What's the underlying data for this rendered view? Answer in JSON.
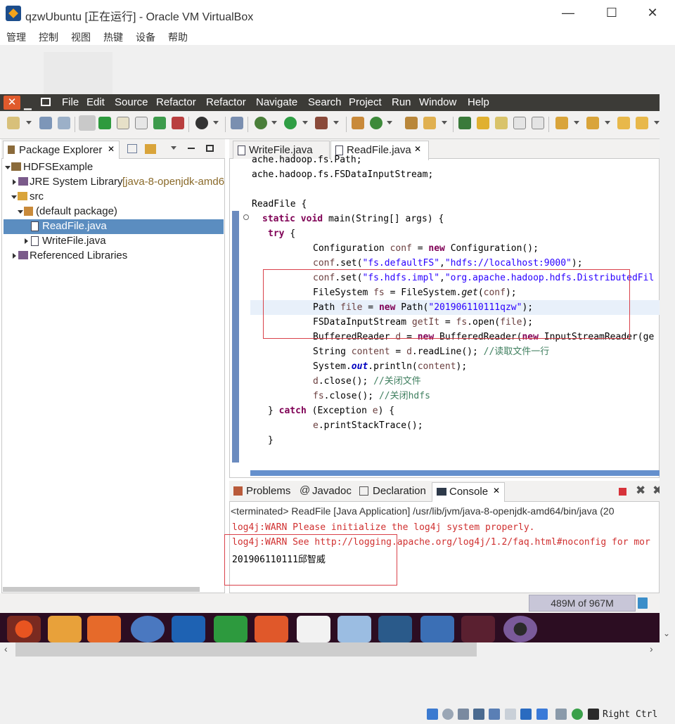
{
  "vbox": {
    "title": "qzwUbuntu [正在运行] - Oracle VM VirtualBox",
    "menu": [
      "管理",
      "控制",
      "视图",
      "热键",
      "设备",
      "帮助"
    ],
    "win_min": "—",
    "win_max": "☐",
    "win_close": "✕",
    "host_key": "Right Ctrl"
  },
  "eclipse": {
    "close_glyph": "✕",
    "min_glyph": "▁",
    "menu": [
      "File",
      "Edit",
      "Source",
      "Refactor",
      "Refactor",
      "Navigate",
      "Search",
      "Project",
      "Run",
      "Window",
      "Help"
    ],
    "package_explorer": {
      "tab_label": "Package Explorer",
      "tab_close": "✕",
      "tree": [
        {
          "label": "HDFSExample",
          "suffix": ""
        },
        {
          "label": "JRE System Library",
          "suffix": "[java-8-openjdk-amd6"
        },
        {
          "label": "src",
          "suffix": ""
        },
        {
          "label": "(default package)",
          "suffix": ""
        },
        {
          "label": "ReadFile.java",
          "suffix": ""
        },
        {
          "label": "WriteFile.java",
          "suffix": ""
        },
        {
          "label": "Referenced Libraries",
          "suffix": ""
        }
      ]
    },
    "editor": {
      "tabs": [
        {
          "label": "WriteFile.java",
          "active": false
        },
        {
          "label": "ReadFile.java",
          "active": true,
          "close": "✕"
        }
      ],
      "code": {
        "l1": "ache.hadoop.fs.Path;",
        "l2": "ache.hadoop.fs.FSDataInputStream;",
        "l4a": "ReadFile {",
        "l5a": "static",
        "l5b": "void",
        "l5c": "main(String[] args) {",
        "l6a": "try",
        "l6b": "{",
        "l7a": "Configuration",
        "l7b": "conf",
        "l7c": "=",
        "l7d": "new",
        "l7e": "Configuration();",
        "l8a": "conf",
        "l8b": ".set(",
        "l8c": "\"fs.defaultFS\"",
        "l8d": ",",
        "l8e": "\"hdfs://localhost:9000\"",
        "l8f": ");",
        "l9a": "conf",
        "l9b": ".set(",
        "l9c": "\"fs.hdfs.impl\"",
        "l9d": ",",
        "l9e": "\"org.apache.hadoop.hdfs.DistributedFil",
        "l10a": "FileSystem",
        "l10b": "fs",
        "l10c": "= FileSystem.",
        "l10d": "get",
        "l10e": "(",
        "l10f": "conf",
        "l10g": ");",
        "l11a": "Path",
        "l11b": "file",
        "l11c": "=",
        "l11d": "new",
        "l11e": "Path(",
        "l11f": "\"201906110111qzw\"",
        "l11g": ");",
        "l12a": "FSDataInputStream",
        "l12b": "getIt",
        "l12c": "=",
        "l12d": "fs",
        "l12e": ".open(",
        "l12f": "file",
        "l12g": ");",
        "l13a": "BufferedReader",
        "l13b": "d",
        "l13c": "=",
        "l13d": "new",
        "l13e": "BufferedReader(",
        "l13f": "new",
        "l13g": "InputStreamReader(ge",
        "l14a": "String",
        "l14b": "content",
        "l14c": "=",
        "l14d": "d",
        "l14e": ".readLine();",
        "l14f": "//读取文件一行",
        "l15a": "System.",
        "l15b": "out",
        "l15c": ".println(",
        "l15d": "content",
        "l15e": ");",
        "l16a": "d",
        "l16b": ".close();",
        "l16c": "//关闭文件",
        "l17a": "fs",
        "l17b": ".close();",
        "l17c": "//关闭hdfs",
        "l18a": "}",
        "l18b": "catch",
        "l18c": "(Exception",
        "l18d": "e",
        "l18e": ") {",
        "l19a": "e",
        "l19b": ".printStackTrace();",
        "l20a": "}"
      }
    },
    "console": {
      "tabs": [
        "Problems",
        "Javadoc",
        "Declaration",
        "Console"
      ],
      "console_close": "✕",
      "header": "<terminated> ReadFile [Java Application] /usr/lib/jvm/java-8-openjdk-amd64/bin/java (20",
      "warn1": "log4j:WARN Please initialize the log4j system properly.",
      "warn2": "log4j:WARN See http://logging.apache.org/log4j/1.2/faq.html#noconfig for mor",
      "output": "201906110111邱智威"
    },
    "heap_status": "489M of 967M"
  },
  "colors": {
    "ubuntu_dark": "#3c3b37",
    "selection": "#5b8dc0",
    "annotation_red": "#d9414a",
    "keyword": "#7f0055",
    "string": "#2a00ff",
    "comment": "#3f7f5f",
    "console_err": "#d03030",
    "dock_bg": "#2c0d22"
  }
}
